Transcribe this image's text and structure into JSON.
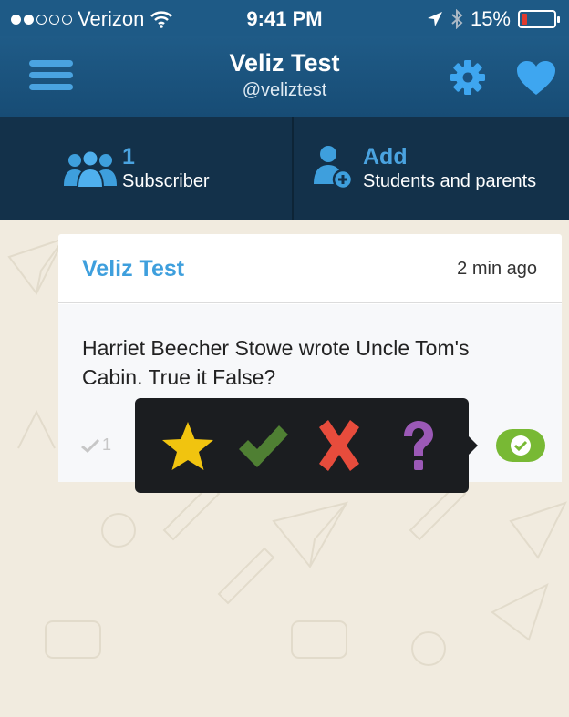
{
  "status_bar": {
    "carrier": "Verizon",
    "time": "9:41 PM",
    "battery": "15%",
    "battery_level": 0.15,
    "signal_bars": 2,
    "icons": [
      "wifi-icon",
      "location-arrow-icon",
      "bluetooth-icon",
      "battery-icon"
    ]
  },
  "nav": {
    "title": "Veliz Test",
    "handle": "@veliztest",
    "icons": [
      "menu-icon",
      "gear-icon",
      "heart-icon"
    ]
  },
  "subscribers": {
    "count": "1",
    "count_label": "Subscriber",
    "add_label": "Add",
    "add_sublabel": "Students and parents",
    "icons": [
      "group-icon",
      "add-person-icon"
    ]
  },
  "post": {
    "author": "Veliz Test",
    "time": "2 min ago",
    "text": "Harriet Beecher Stowe wrote Uncle Tom's Cabin. True it False?",
    "check_count": "1"
  },
  "reactions": {
    "items": [
      "star-icon",
      "checkmark-icon",
      "x-icon",
      "question-icon"
    ],
    "colors": {
      "star": "#f1c40f",
      "check": "#4f7f33",
      "x": "#e74c3c",
      "question": "#9b59b6"
    }
  },
  "colors": {
    "nav_bg": "#1f5b87",
    "sub_bg": "#13314a",
    "accent_blue": "#3e9fdd",
    "accent_green": "#78b934",
    "page_bg": "#f1ebdf"
  }
}
